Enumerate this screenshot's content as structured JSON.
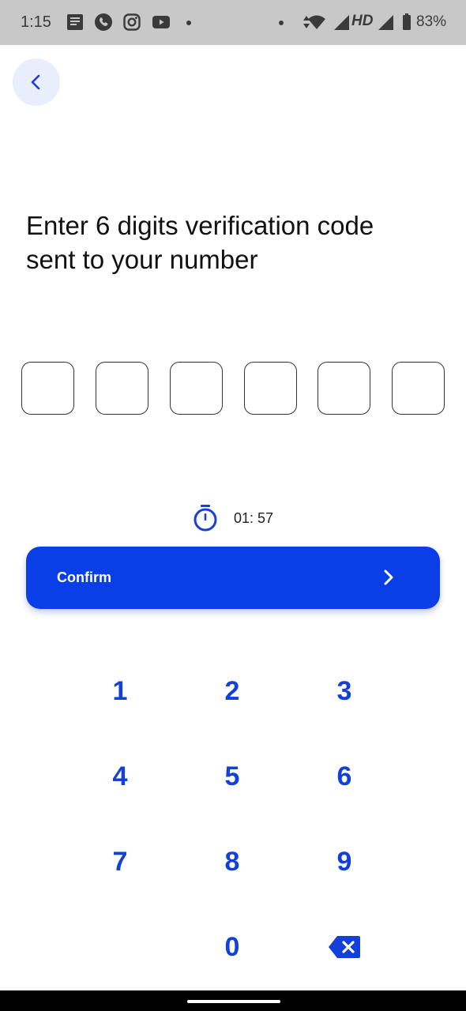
{
  "status_bar": {
    "time": "1:15",
    "network": "HD",
    "battery": "83%",
    "icons": [
      "news-icon",
      "phone-icon",
      "instagram-icon",
      "youtube-icon",
      "wifi-icon",
      "signal-icon",
      "battery-icon"
    ]
  },
  "header": {
    "back_icon": "chevron-left-icon"
  },
  "main": {
    "title_line1": "Enter 6 digits verification code",
    "title_line2": "sent to your number",
    "otp_digits": [
      "",
      "",
      "",
      "",
      "",
      ""
    ],
    "timer": "01: 57",
    "confirm_label": "Confirm"
  },
  "keypad": {
    "keys": [
      "1",
      "2",
      "3",
      "4",
      "5",
      "6",
      "7",
      "8",
      "9",
      "0"
    ],
    "backspace_icon": "backspace-icon"
  },
  "colors": {
    "accent": "#0a3ee6",
    "key_text": "#1240d8",
    "back_bg": "#e8eefc",
    "status_bar_bg": "#c8c8c8"
  }
}
